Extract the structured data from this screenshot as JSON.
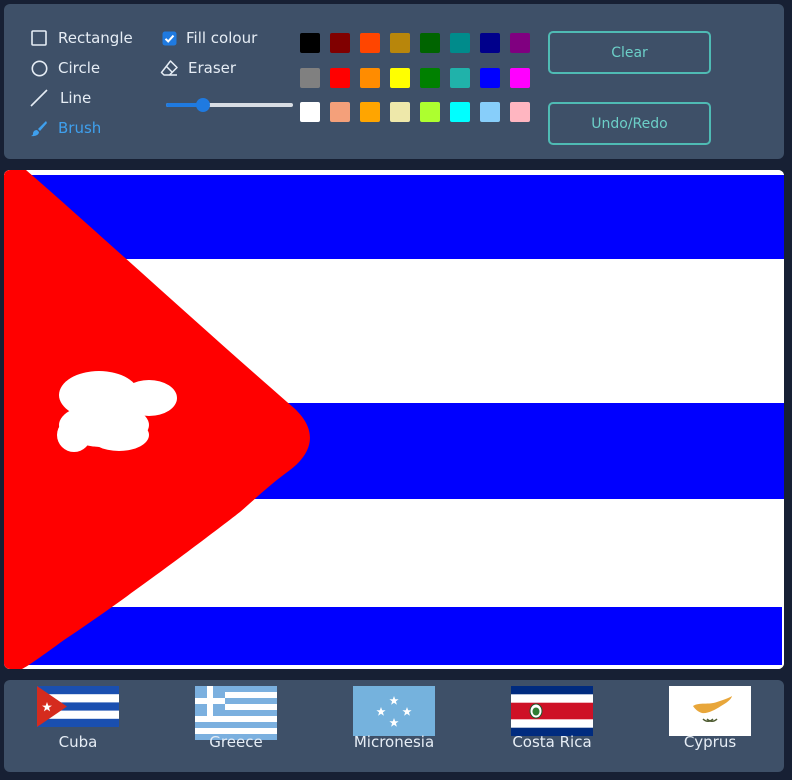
{
  "tools": {
    "rectangle": "Rectangle",
    "circle": "Circle",
    "line": "Line",
    "brush": "Brush",
    "fill_colour": "Fill colour",
    "eraser": "Eraser",
    "fill_checked": true,
    "active": "brush"
  },
  "brush_size_fraction": 0.3,
  "palette": [
    "#000000",
    "#800000",
    "#ff4500",
    "#b8860b",
    "#006400",
    "#008b8b",
    "#00008b",
    "#800080",
    "#808080",
    "#ff0000",
    "#ff8c00",
    "#ffff00",
    "#008000",
    "#20b2aa",
    "#0000ff",
    "#ff00ff",
    "#ffffff",
    "#f4a07a",
    "#ffa500",
    "#eee8aa",
    "#adff2f",
    "#00ffff",
    "#87cefa",
    "#ffb6c1"
  ],
  "buttons": {
    "clear": "Clear",
    "undo_redo": "Undo/Redo"
  },
  "flags": [
    {
      "name": "Cuba"
    },
    {
      "name": "Greece"
    },
    {
      "name": "Micronesia"
    },
    {
      "name": "Costa Rica"
    },
    {
      "name": "Cyprus"
    }
  ],
  "colors": {
    "panel": "#3e5068",
    "background": "#172034",
    "accent": "#3fa0ee",
    "button_border": "#4fbbb4"
  }
}
